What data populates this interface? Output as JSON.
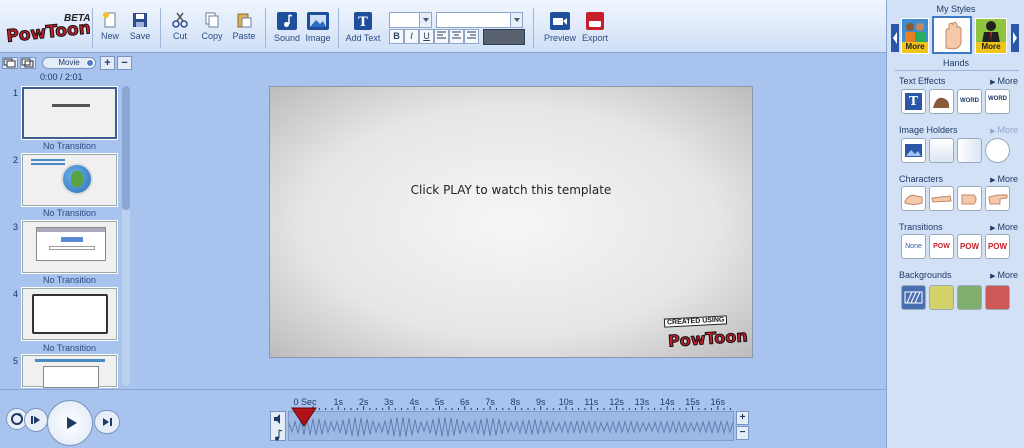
{
  "toolbar": {
    "logo_text": "PowToon",
    "beta_label": "BETA",
    "buttons": {
      "new": "New",
      "save": "Save",
      "cut": "Cut",
      "copy": "Copy",
      "paste": "Paste",
      "sound": "Sound",
      "image": "Image",
      "add_text": "Add Text",
      "preview": "Preview",
      "export": "Export"
    },
    "format": {
      "bold": "B",
      "italic": "I",
      "underline": "U"
    }
  },
  "left_panel": {
    "mode_label": "Movie",
    "time": "0:00 / 2:01",
    "add": "+",
    "remove": "−",
    "slides": [
      {
        "num": "1",
        "transition": "No Transition"
      },
      {
        "num": "2",
        "transition": "No Transition"
      },
      {
        "num": "3",
        "transition": "No Transition"
      },
      {
        "num": "4",
        "transition": "No Transition"
      },
      {
        "num": "5",
        "transition": ""
      }
    ]
  },
  "stage": {
    "message": "Click PLAY to watch this template",
    "watermark_top": "CREATED USING",
    "watermark_logo": "PowToon"
  },
  "right_panel": {
    "title": "My Styles",
    "style_name": "Hands",
    "more": "More",
    "sections": {
      "text_effects": "Text Effects",
      "image_holders": "Image Holders",
      "characters": "Characters",
      "transitions": "Transitions",
      "backgrounds": "Backgrounds"
    },
    "transition_tiles": [
      "None",
      "POW",
      "POW",
      "POW"
    ],
    "text_effect_tiles": [
      "T",
      "",
      "WORD",
      "WORD"
    ],
    "background_colors": [
      "#d5d26b",
      "#7fae6e",
      "#cd5a57"
    ]
  },
  "timeline": {
    "ticks": [
      "0 Sec",
      "1s",
      "2s",
      "3s",
      "4s",
      "5s",
      "6s",
      "7s",
      "8s",
      "9s",
      "10s",
      "11s",
      "12s",
      "13s",
      "14s",
      "15s",
      "16s"
    ],
    "plus": "+",
    "minus": "−"
  }
}
